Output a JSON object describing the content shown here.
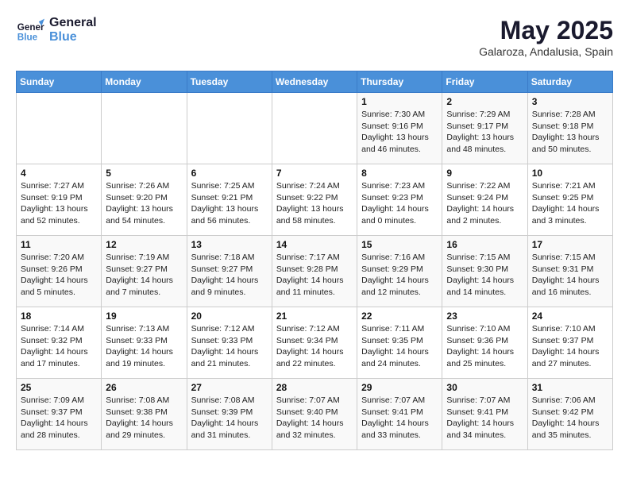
{
  "logo": {
    "line1": "General",
    "line2": "Blue"
  },
  "title": "May 2025",
  "location": "Galaroza, Andalusia, Spain",
  "days_of_week": [
    "Sunday",
    "Monday",
    "Tuesday",
    "Wednesday",
    "Thursday",
    "Friday",
    "Saturday"
  ],
  "weeks": [
    [
      {
        "day": "",
        "info": ""
      },
      {
        "day": "",
        "info": ""
      },
      {
        "day": "",
        "info": ""
      },
      {
        "day": "",
        "info": ""
      },
      {
        "day": "1",
        "info": "Sunrise: 7:30 AM\nSunset: 9:16 PM\nDaylight: 13 hours\nand 46 minutes."
      },
      {
        "day": "2",
        "info": "Sunrise: 7:29 AM\nSunset: 9:17 PM\nDaylight: 13 hours\nand 48 minutes."
      },
      {
        "day": "3",
        "info": "Sunrise: 7:28 AM\nSunset: 9:18 PM\nDaylight: 13 hours\nand 50 minutes."
      }
    ],
    [
      {
        "day": "4",
        "info": "Sunrise: 7:27 AM\nSunset: 9:19 PM\nDaylight: 13 hours\nand 52 minutes."
      },
      {
        "day": "5",
        "info": "Sunrise: 7:26 AM\nSunset: 9:20 PM\nDaylight: 13 hours\nand 54 minutes."
      },
      {
        "day": "6",
        "info": "Sunrise: 7:25 AM\nSunset: 9:21 PM\nDaylight: 13 hours\nand 56 minutes."
      },
      {
        "day": "7",
        "info": "Sunrise: 7:24 AM\nSunset: 9:22 PM\nDaylight: 13 hours\nand 58 minutes."
      },
      {
        "day": "8",
        "info": "Sunrise: 7:23 AM\nSunset: 9:23 PM\nDaylight: 14 hours\nand 0 minutes."
      },
      {
        "day": "9",
        "info": "Sunrise: 7:22 AM\nSunset: 9:24 PM\nDaylight: 14 hours\nand 2 minutes."
      },
      {
        "day": "10",
        "info": "Sunrise: 7:21 AM\nSunset: 9:25 PM\nDaylight: 14 hours\nand 3 minutes."
      }
    ],
    [
      {
        "day": "11",
        "info": "Sunrise: 7:20 AM\nSunset: 9:26 PM\nDaylight: 14 hours\nand 5 minutes."
      },
      {
        "day": "12",
        "info": "Sunrise: 7:19 AM\nSunset: 9:27 PM\nDaylight: 14 hours\nand 7 minutes."
      },
      {
        "day": "13",
        "info": "Sunrise: 7:18 AM\nSunset: 9:27 PM\nDaylight: 14 hours\nand 9 minutes."
      },
      {
        "day": "14",
        "info": "Sunrise: 7:17 AM\nSunset: 9:28 PM\nDaylight: 14 hours\nand 11 minutes."
      },
      {
        "day": "15",
        "info": "Sunrise: 7:16 AM\nSunset: 9:29 PM\nDaylight: 14 hours\nand 12 minutes."
      },
      {
        "day": "16",
        "info": "Sunrise: 7:15 AM\nSunset: 9:30 PM\nDaylight: 14 hours\nand 14 minutes."
      },
      {
        "day": "17",
        "info": "Sunrise: 7:15 AM\nSunset: 9:31 PM\nDaylight: 14 hours\nand 16 minutes."
      }
    ],
    [
      {
        "day": "18",
        "info": "Sunrise: 7:14 AM\nSunset: 9:32 PM\nDaylight: 14 hours\nand 17 minutes."
      },
      {
        "day": "19",
        "info": "Sunrise: 7:13 AM\nSunset: 9:33 PM\nDaylight: 14 hours\nand 19 minutes."
      },
      {
        "day": "20",
        "info": "Sunrise: 7:12 AM\nSunset: 9:33 PM\nDaylight: 14 hours\nand 21 minutes."
      },
      {
        "day": "21",
        "info": "Sunrise: 7:12 AM\nSunset: 9:34 PM\nDaylight: 14 hours\nand 22 minutes."
      },
      {
        "day": "22",
        "info": "Sunrise: 7:11 AM\nSunset: 9:35 PM\nDaylight: 14 hours\nand 24 minutes."
      },
      {
        "day": "23",
        "info": "Sunrise: 7:10 AM\nSunset: 9:36 PM\nDaylight: 14 hours\nand 25 minutes."
      },
      {
        "day": "24",
        "info": "Sunrise: 7:10 AM\nSunset: 9:37 PM\nDaylight: 14 hours\nand 27 minutes."
      }
    ],
    [
      {
        "day": "25",
        "info": "Sunrise: 7:09 AM\nSunset: 9:37 PM\nDaylight: 14 hours\nand 28 minutes."
      },
      {
        "day": "26",
        "info": "Sunrise: 7:08 AM\nSunset: 9:38 PM\nDaylight: 14 hours\nand 29 minutes."
      },
      {
        "day": "27",
        "info": "Sunrise: 7:08 AM\nSunset: 9:39 PM\nDaylight: 14 hours\nand 31 minutes."
      },
      {
        "day": "28",
        "info": "Sunrise: 7:07 AM\nSunset: 9:40 PM\nDaylight: 14 hours\nand 32 minutes."
      },
      {
        "day": "29",
        "info": "Sunrise: 7:07 AM\nSunset: 9:41 PM\nDaylight: 14 hours\nand 33 minutes."
      },
      {
        "day": "30",
        "info": "Sunrise: 7:07 AM\nSunset: 9:41 PM\nDaylight: 14 hours\nand 34 minutes."
      },
      {
        "day": "31",
        "info": "Sunrise: 7:06 AM\nSunset: 9:42 PM\nDaylight: 14 hours\nand 35 minutes."
      }
    ]
  ]
}
